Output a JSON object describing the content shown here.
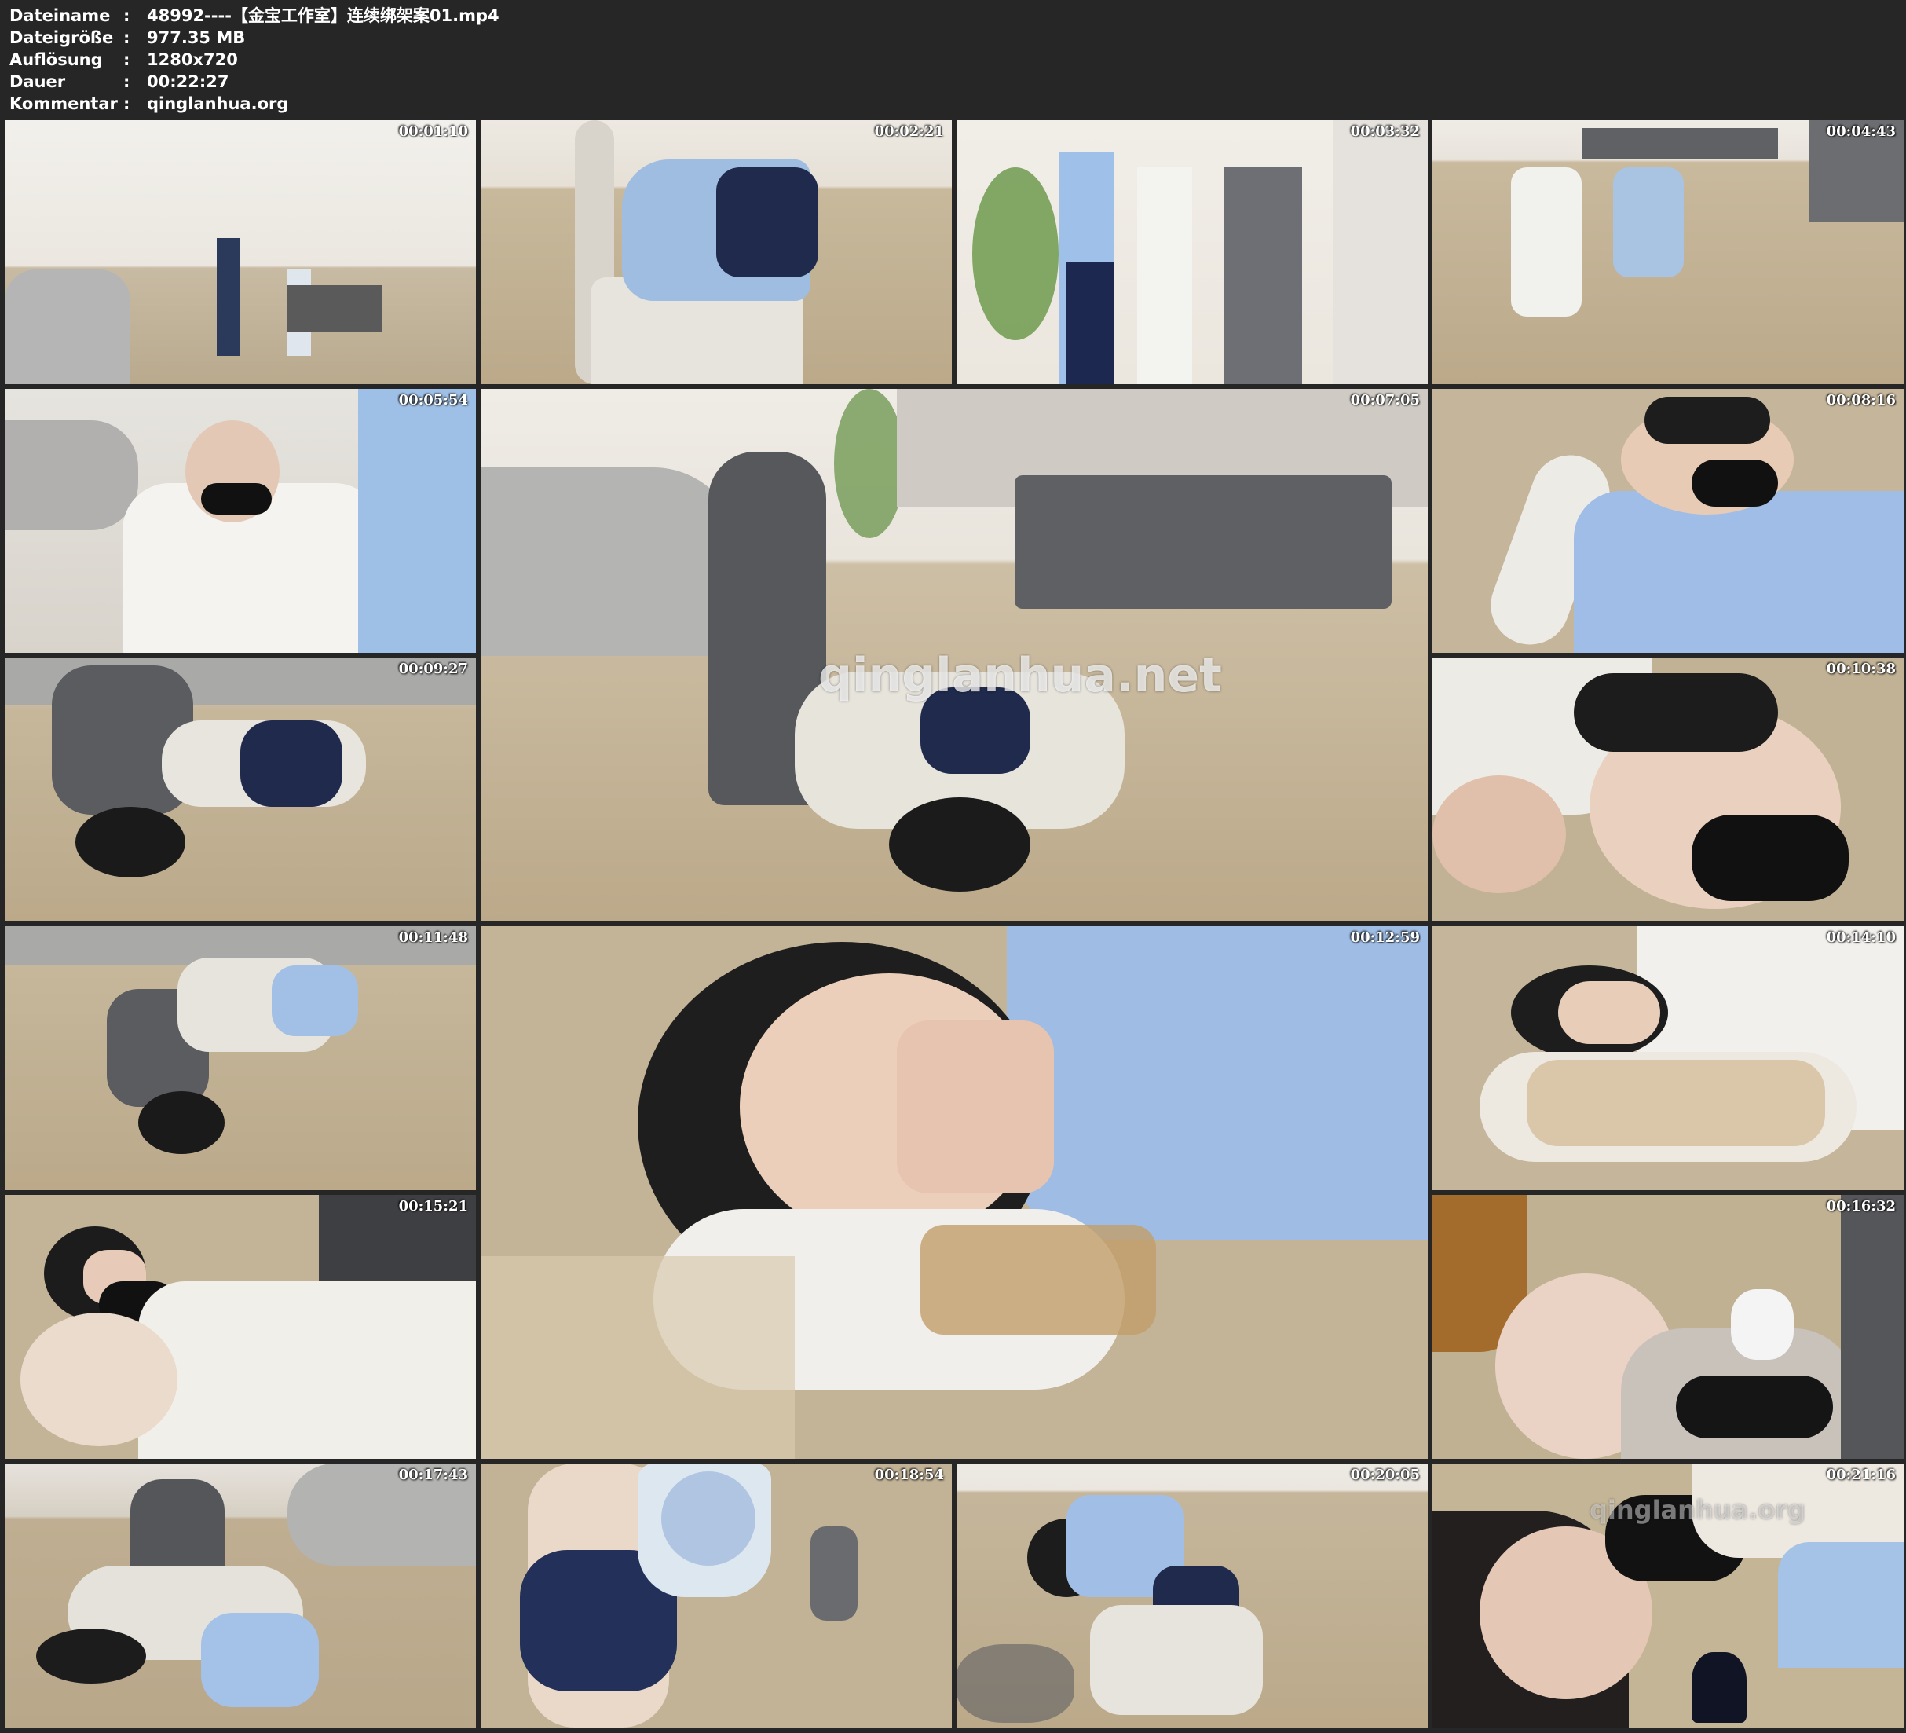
{
  "file_info": {
    "rows": [
      {
        "label": "Dateiname",
        "value": "48992----【金宝工作室】连续绑架案01.mp4"
      },
      {
        "label": "Dateigröße",
        "value": "977.35 MB"
      },
      {
        "label": "Auflösung",
        "value": "1280x720"
      },
      {
        "label": "Dauer",
        "value": "00:22:27"
      },
      {
        "label": "Kommentar",
        "value": "qinglanhua.org"
      }
    ],
    "separator": ":"
  },
  "frames": [
    {
      "timestamp": "00:01:10"
    },
    {
      "timestamp": "00:02:21"
    },
    {
      "timestamp": "00:03:32"
    },
    {
      "timestamp": "00:04:43"
    },
    {
      "timestamp": "00:05:54"
    },
    {
      "timestamp": "00:07:05"
    },
    {
      "timestamp": "00:08:16"
    },
    {
      "timestamp": "00:09:27"
    },
    {
      "timestamp": "00:10:38"
    },
    {
      "timestamp": "00:11:48"
    },
    {
      "timestamp": "00:12:59"
    },
    {
      "timestamp": "00:14:10"
    },
    {
      "timestamp": "00:15:21"
    },
    {
      "timestamp": "00:16:32"
    },
    {
      "timestamp": "00:17:43"
    },
    {
      "timestamp": "00:18:54"
    },
    {
      "timestamp": "00:20:05"
    },
    {
      "timestamp": "00:21:16"
    }
  ],
  "watermarks": {
    "large": "qinglanhua.net",
    "small": "qinglanhua.org"
  }
}
